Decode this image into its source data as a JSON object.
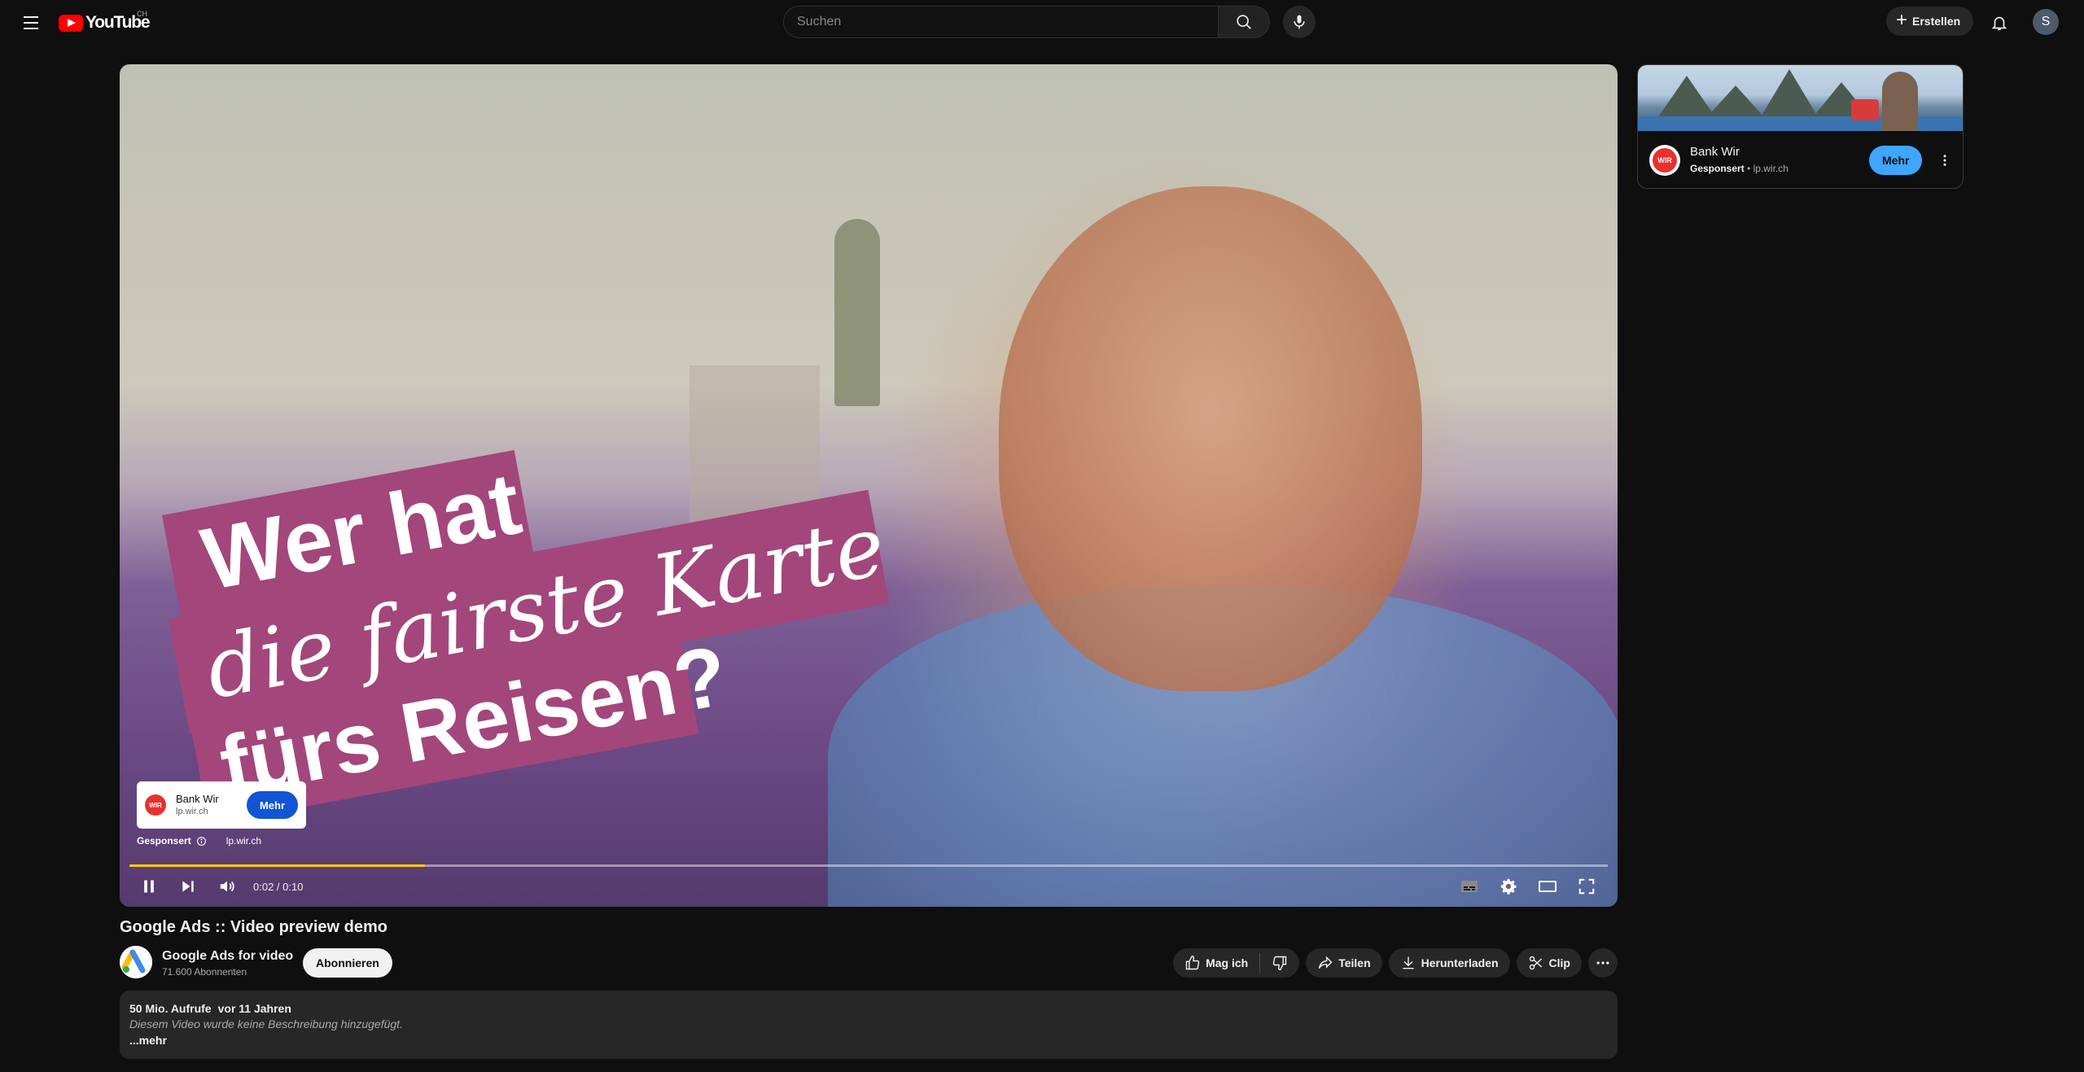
{
  "header": {
    "logo_text": "YouTube",
    "country_code": "CH",
    "search_placeholder": "Suchen",
    "create_label": "Erstellen",
    "avatar_initial": "S"
  },
  "player": {
    "headline_line1": "Wer hat",
    "headline_line2": "die fairste Karte",
    "headline_line3": "fürs Reisen?",
    "ad_overlay": {
      "advertiser": "Bank Wir",
      "url": "lp.wir.ch",
      "button_label": "Mehr",
      "logo_text": "WIR",
      "sponsored_label": "Gesponsert"
    },
    "time_display": "0:02 / 0:10",
    "progress_fraction": 0.2,
    "colors": {
      "progress_fill": "#ffcc00",
      "headline_background": "#a3467b"
    }
  },
  "video": {
    "title": "Google Ads :: Video preview demo",
    "channel_name": "Google Ads for video",
    "subscriber_count": "71.600 Abonnenten",
    "subscribe_label": "Abonnieren",
    "actions": {
      "like_label": "Mag ich",
      "share_label": "Teilen",
      "download_label": "Herunterladen",
      "clip_label": "Clip"
    },
    "description": {
      "views": "50 Mio. Aufrufe",
      "age": "vor 11 Jahren",
      "text": "Diesem Video wurde keine Beschreibung hinzugefügt.",
      "more_label": "...mehr"
    }
  },
  "sidebar_ad": {
    "advertiser": "Bank Wir",
    "sponsored_label": "Gesponsert",
    "separator": "•",
    "url": "lp.wir.ch",
    "button_label": "Mehr",
    "logo_text": "WIR",
    "colors": {
      "button": "#3ea6ff"
    }
  }
}
